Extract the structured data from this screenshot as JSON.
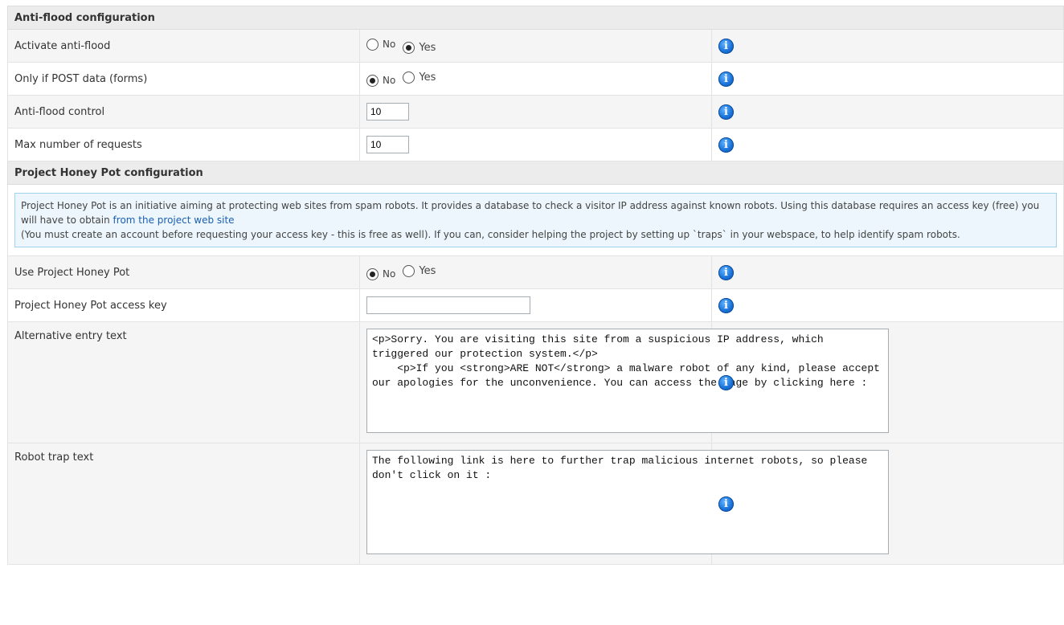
{
  "sections": {
    "antiflood_title": "Anti-flood configuration",
    "honeypot_title": "Project Honey Pot configuration"
  },
  "rows": {
    "activate": {
      "label": "Activate anti-flood",
      "no": "No",
      "yes": "Yes",
      "selected": "Yes"
    },
    "post_only": {
      "label": "Only if POST data (forms)",
      "no": "No",
      "yes": "Yes",
      "selected": "No"
    },
    "control": {
      "label": "Anti-flood control",
      "value": "10"
    },
    "max_requests": {
      "label": "Max number of requests",
      "value": "10"
    },
    "use_honeypot": {
      "label": "Use Project Honey Pot",
      "no": "No",
      "yes": "Yes",
      "selected": "No"
    },
    "access_key": {
      "label": "Project Honey Pot access key",
      "value": ""
    },
    "alt_entry": {
      "label": "Alternative entry text",
      "value": "<p>Sorry. You are visiting this site from a suspicious IP address, which triggered our protection system.</p>\n    <p>If you <strong>ARE NOT</strong> a malware robot of any kind, please accept our apologies for the unconvenience. You can access the page by clicking here :"
    },
    "robot_trap": {
      "label": "Robot trap text",
      "value": "The following link is here to further trap malicious internet robots, so please don't click on it :"
    }
  },
  "notice": {
    "text1": "Project Honey Pot is an initiative aiming at protecting web sites from spam robots. It provides a database to check a visitor IP address against known robots. Using this database requires an access key (free) you will have to obtain",
    "link": "from the project web site",
    "text2": "(You must create an account before requesting your access key - this is free as well). If you can, consider helping the project by setting up `traps` in your webspace, to help identify spam robots."
  },
  "icons": {
    "info": "info-icon",
    "info_glyph": "i"
  },
  "colors": {
    "header_bg": "#ececec",
    "notice_bg": "#ecf6fc",
    "notice_border": "#9fd3ee",
    "link": "#1a5fb4",
    "info_blue": "#1a73d9"
  }
}
